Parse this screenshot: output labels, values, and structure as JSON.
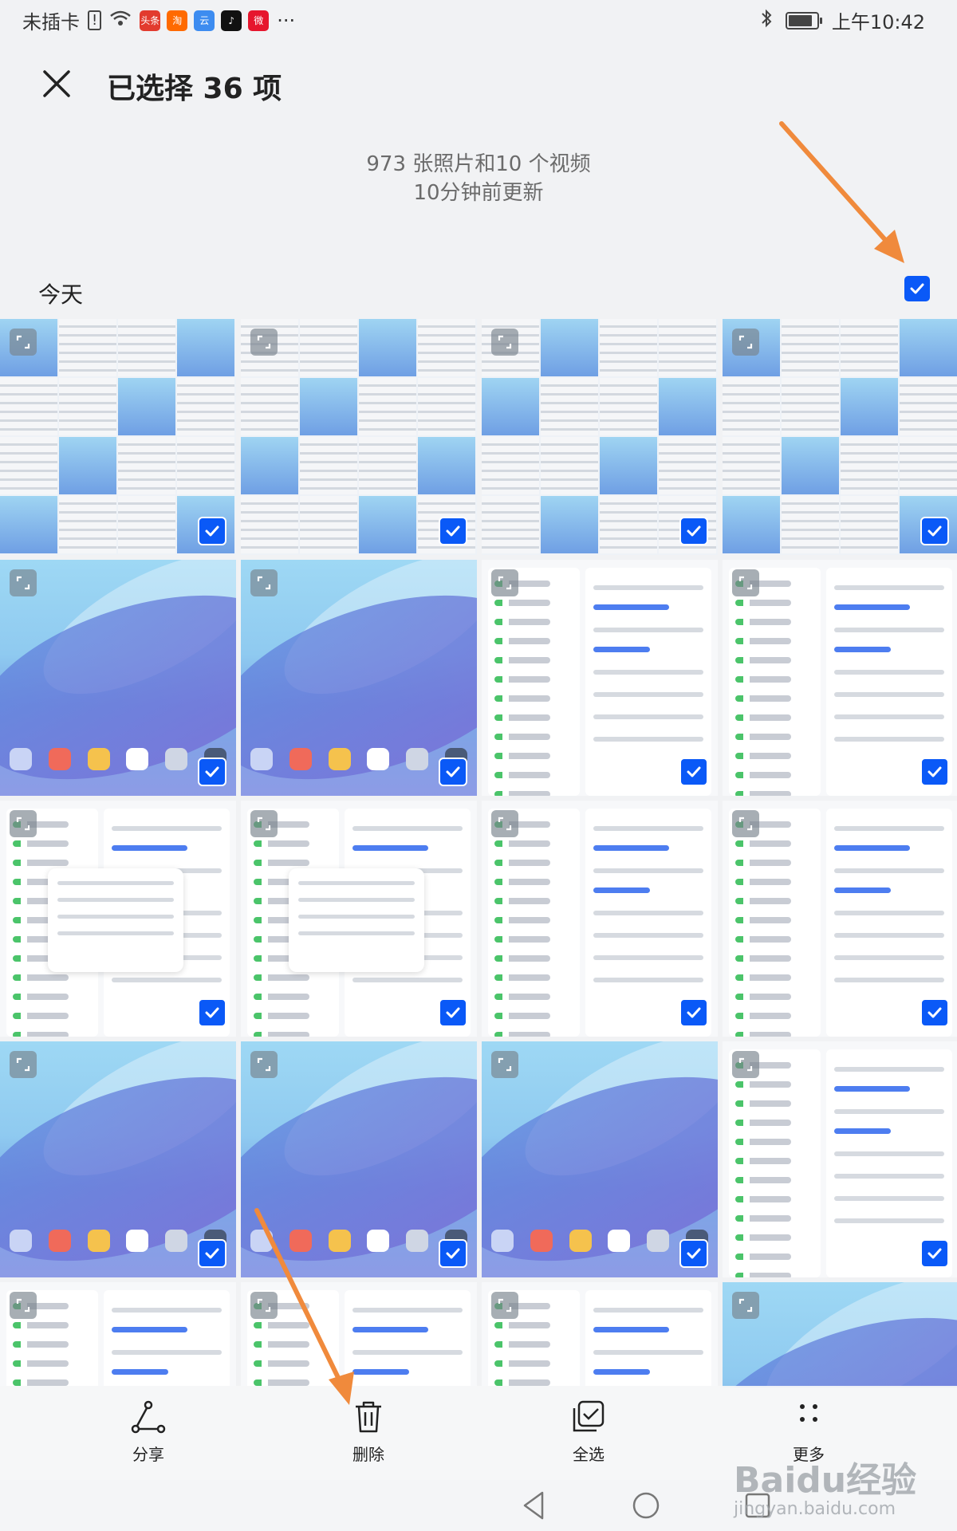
{
  "status_bar": {
    "carrier": "未插卡",
    "apps": [
      {
        "name": "toutiao",
        "label": "头条",
        "color": "#e23b2e"
      },
      {
        "name": "taobao",
        "label": "淘",
        "color": "#ff6a00"
      },
      {
        "name": "baidu-netdisk",
        "label": "云",
        "color": "#3d8cf0"
      },
      {
        "name": "douyin",
        "label": "♪",
        "color": "#111111"
      },
      {
        "name": "weibo",
        "label": "微",
        "color": "#e6162d"
      }
    ],
    "more": "···",
    "time": "上午10:42"
  },
  "header": {
    "title": "已选择 36 项"
  },
  "summary": {
    "line1": "973 张照片和10 个视频",
    "line2": "10分钟前更新"
  },
  "section": {
    "title": "今天",
    "all_selected": true
  },
  "grid": {
    "columns": 4,
    "tiles": [
      {
        "type": "collage",
        "selected": true
      },
      {
        "type": "collage",
        "selected": true
      },
      {
        "type": "collage",
        "selected": true
      },
      {
        "type": "collage",
        "selected": true
      },
      {
        "type": "wallpaper",
        "selected": true
      },
      {
        "type": "wallpaper",
        "selected": true
      },
      {
        "type": "settings",
        "selected": true
      },
      {
        "type": "settings",
        "selected": true
      },
      {
        "type": "settings-dialog",
        "selected": true
      },
      {
        "type": "settings-dialog",
        "selected": true
      },
      {
        "type": "settings",
        "selected": true
      },
      {
        "type": "settings",
        "selected": true
      },
      {
        "type": "wallpaper",
        "selected": true
      },
      {
        "type": "wallpaper",
        "selected": true
      },
      {
        "type": "wallpaper",
        "selected": true
      },
      {
        "type": "settings",
        "selected": true
      },
      {
        "type": "settings",
        "selected": true
      },
      {
        "type": "settings",
        "selected": true
      },
      {
        "type": "settings",
        "selected": true
      },
      {
        "type": "wallpaper",
        "selected": true
      }
    ]
  },
  "toolbar": {
    "share": "分享",
    "delete": "删除",
    "select_all": "全选",
    "more": "更多"
  },
  "watermark": {
    "brand": "Baidu经验",
    "url": "jingyan.baidu.com"
  },
  "colors": {
    "accent": "#0a59f7",
    "annotation": "#f08a3c"
  }
}
